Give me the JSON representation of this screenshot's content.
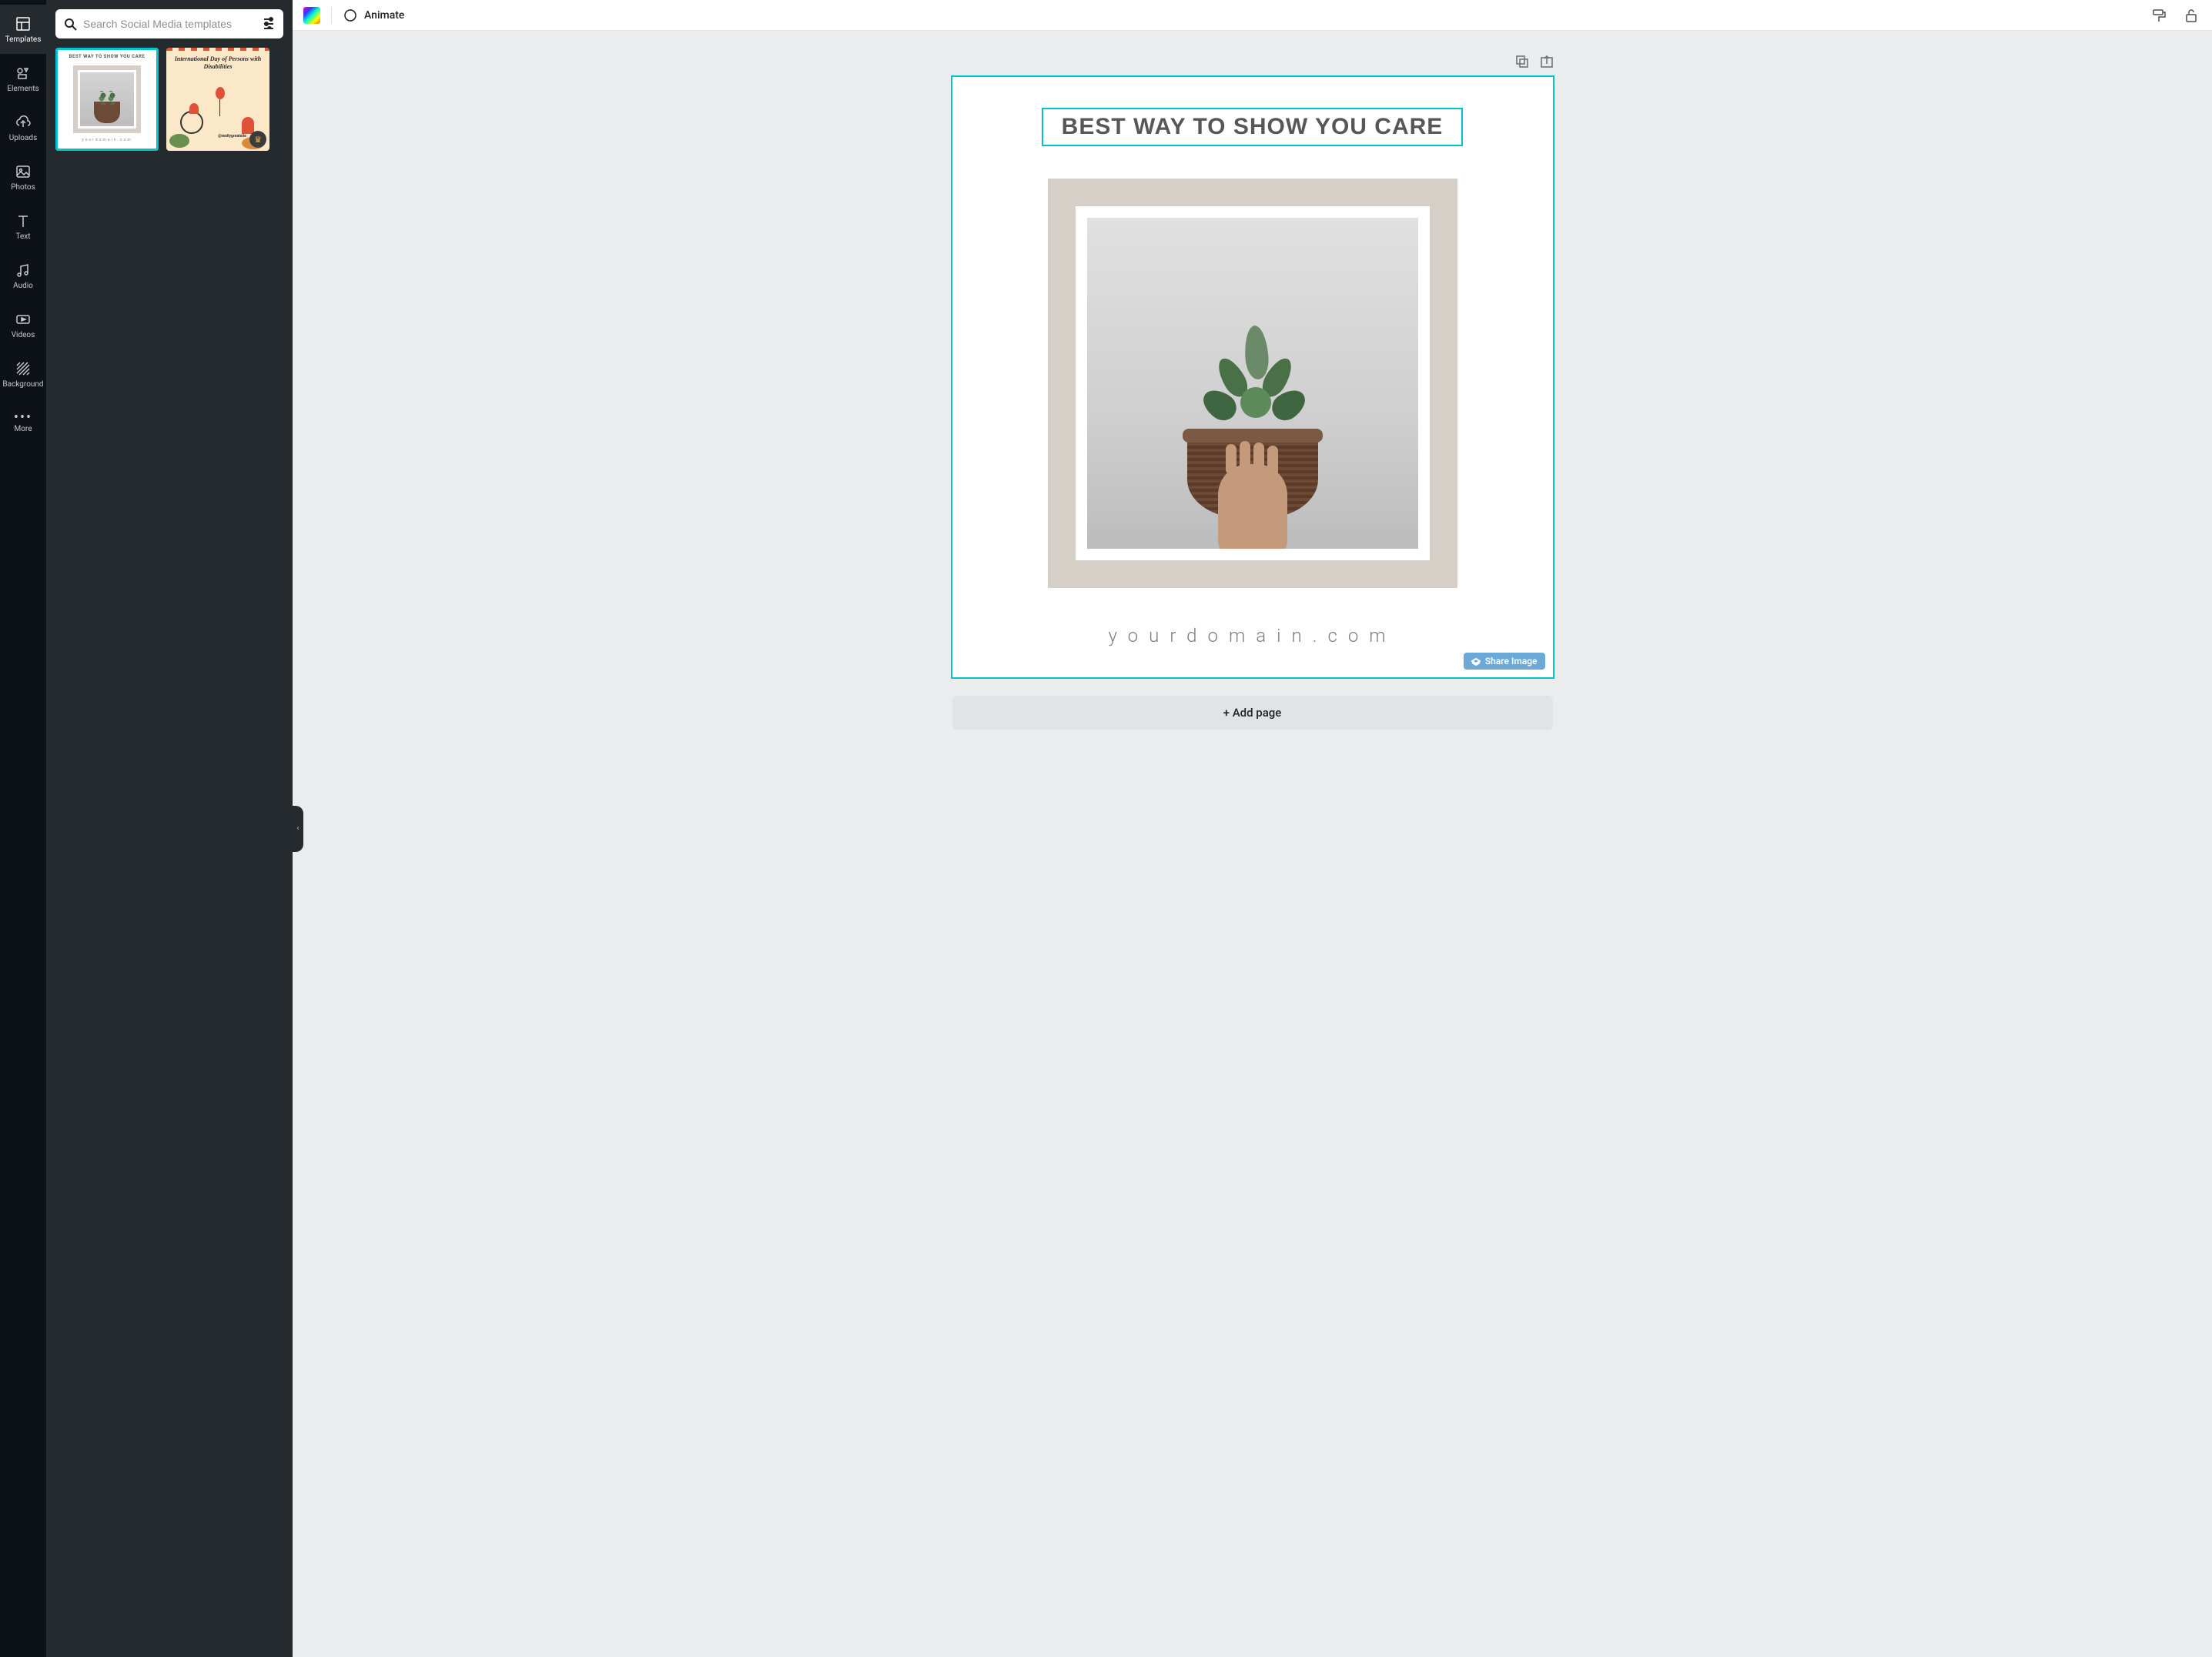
{
  "rail": {
    "templates": "Templates",
    "elements": "Elements",
    "uploads": "Uploads",
    "photos": "Photos",
    "text": "Text",
    "audio": "Audio",
    "videos": "Videos",
    "background": "Background",
    "more": "More"
  },
  "search": {
    "placeholder": "Search Social Media templates"
  },
  "thumbs": {
    "t1": {
      "title": "BEST WAY TO SHOW YOU CARE",
      "domain": "yourdomain.com"
    },
    "t2": {
      "title": "International Day of Persons with Disabilities",
      "handle": "@reallygreatsite",
      "crown": "♛"
    }
  },
  "topbar": {
    "animate": "Animate"
  },
  "canvas": {
    "headline": "BEST WAY TO SHOW YOU CARE",
    "domain": "yourdomain.com",
    "share": "Share Image"
  },
  "addPage": "+ Add page"
}
